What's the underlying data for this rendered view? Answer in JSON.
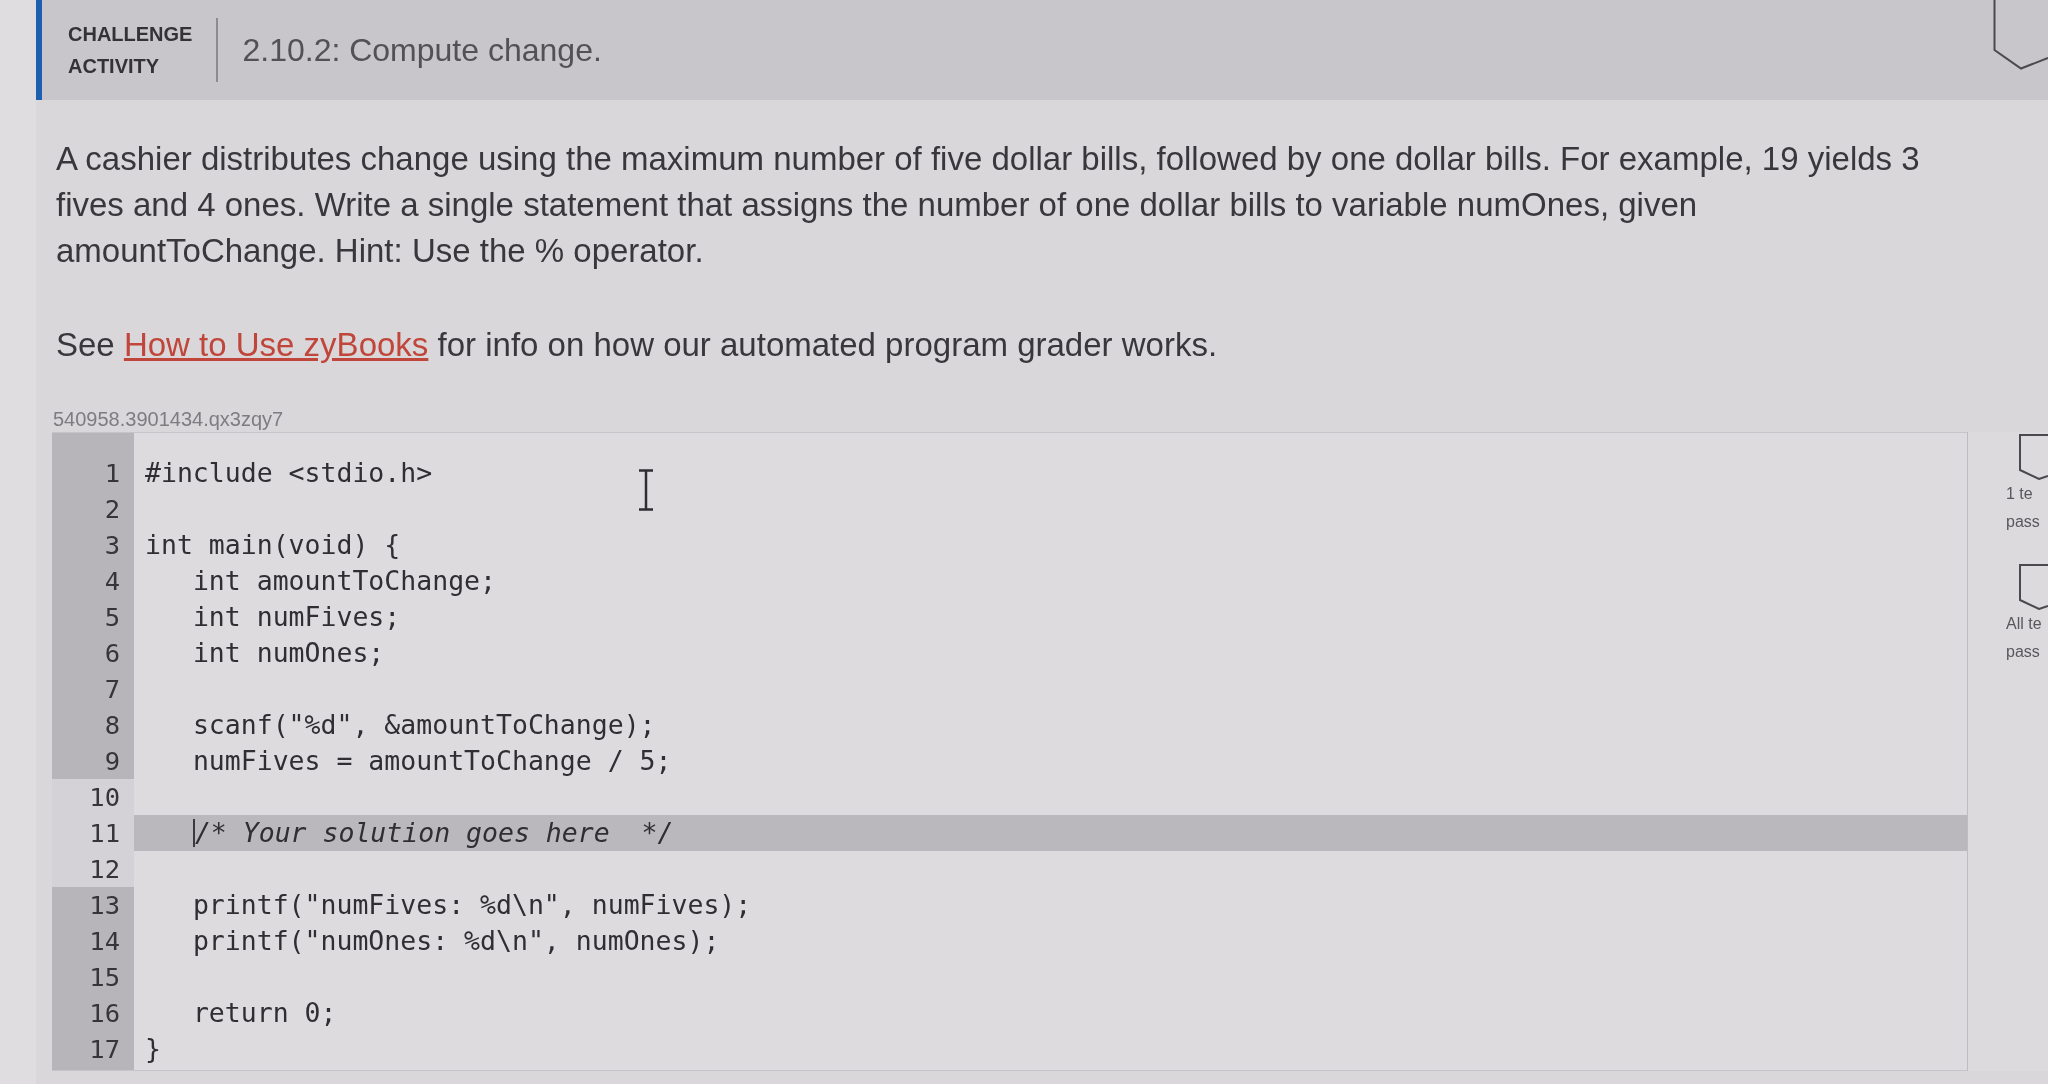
{
  "activity": {
    "label": "CHALLENGE ACTIVITY",
    "title": "2.10.2: Compute change."
  },
  "prompt": "A cashier distributes change using the maximum number of five dollar bills, followed by one dollar bills. For example, 19 yields 3 fives and 4 ones. Write a single statement that assigns the number of one dollar bills to variable numOnes, given amountToChange. Hint: Use the % operator.",
  "grader_note": {
    "before": "See ",
    "link": "How to Use zyBooks",
    "after": " for info on how our automated program grader works."
  },
  "code_id": "540958.3901434.qx3zqy7",
  "editor": {
    "lines": [
      {
        "number": "1",
        "text": "#include <stdio.h>",
        "kind": "code",
        "editable": false,
        "current": false
      },
      {
        "number": "2",
        "kind": "code",
        "editable": false,
        "current": false
      },
      {
        "number": "3",
        "text": "int main(void) {",
        "kind": "code",
        "editable": false,
        "current": false
      },
      {
        "number": "4",
        "text": "   int amountToChange;",
        "kind": "code",
        "editable": false,
        "current": false
      },
      {
        "number": "5",
        "text": "   int numFives;",
        "kind": "code",
        "editable": false,
        "current": false
      },
      {
        "number": "6",
        "text": "   int numOnes;",
        "kind": "code",
        "editable": false,
        "current": false
      },
      {
        "number": "7",
        "kind": "code",
        "editable": false,
        "current": false
      },
      {
        "number": "8",
        "text": "   scanf(\"%d\", &amountToChange);",
        "kind": "code",
        "editable": false,
        "current": false
      },
      {
        "number": "9",
        "text": "   numFives = amountToChange / 5;",
        "kind": "code",
        "editable": false,
        "current": false
      },
      {
        "number": "10",
        "kind": "code",
        "editable": true,
        "current": false
      },
      {
        "number": "11",
        "text": "   /* Your solution goes here  */",
        "kind": "comment",
        "editable": true,
        "current": true
      },
      {
        "number": "12",
        "kind": "code",
        "editable": true,
        "current": false
      },
      {
        "number": "13",
        "text": "   printf(\"numFives: %d\\n\", numFives);",
        "kind": "code",
        "editable": false,
        "current": false
      },
      {
        "number": "14",
        "text": "   printf(\"numOnes: %d\\n\", numOnes);",
        "kind": "code",
        "editable": false,
        "current": false
      },
      {
        "number": "15",
        "kind": "code",
        "editable": false,
        "current": false
      },
      {
        "number": "16",
        "text": "   return 0;",
        "kind": "code",
        "editable": false,
        "current": false
      },
      {
        "number": "17",
        "text": "}",
        "kind": "code",
        "editable": false,
        "current": false
      }
    ]
  },
  "test_markers": [
    {
      "caption_lines": [
        "1 te",
        "pass"
      ]
    },
    {
      "caption_lines": [
        "All te",
        "pass"
      ]
    }
  ]
}
